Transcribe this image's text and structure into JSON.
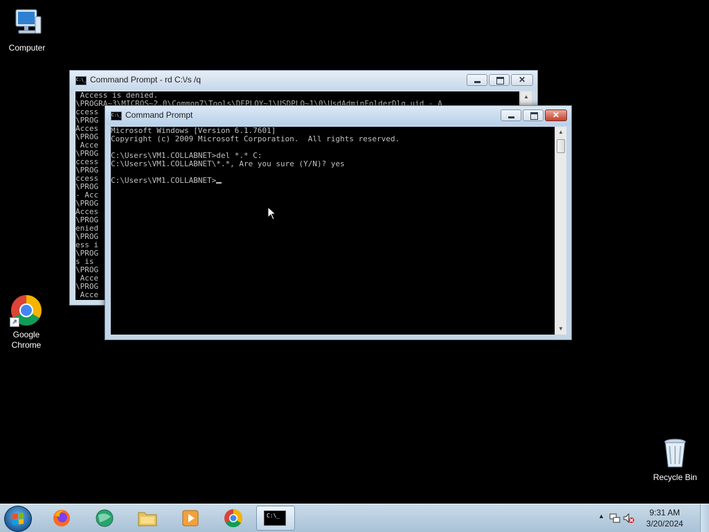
{
  "desktop": {
    "icons": [
      {
        "label": "Computer"
      },
      {
        "label": "Google Chrome"
      },
      {
        "label": "Recycle Bin"
      }
    ]
  },
  "back_window": {
    "title": "Command Prompt - rd  C:\\/s /q",
    "lines": [
      " Access is denied.",
      "\\PROGRA~3\\MICROS~2.0\\Common7\\Tools\\DEPLOY~1\\USDPLO~1\\0\\UsdAdminFolderDlg.uid - A",
      "ccess",
      "\\PROG",
      "Acces",
      "\\PROG",
      " Acce",
      "\\PROG",
      "ccess",
      "\\PROG",
      "ccess",
      "\\PROG",
      "- Acc",
      "\\PROG",
      "Acces",
      "\\PROG",
      "enied",
      "\\PROG",
      "ess i",
      "\\PROG",
      "s is",
      "\\PROG",
      " Acce",
      "\\PROG",
      " Acce"
    ]
  },
  "front_window": {
    "title": "Command Prompt",
    "lines": [
      "Microsoft Windows [Version 6.1.7601]",
      "Copyright (c) 2009 Microsoft Corporation.  All rights reserved.",
      "",
      "C:\\Users\\VM1.COLLABNET>del *.* C:",
      "C:\\Users\\VM1.COLLABNET\\*.*, Are you sure (Y/N)? yes",
      "",
      "C:\\Users\\VM1.COLLABNET>"
    ]
  },
  "window_buttons": {
    "minimize": "—",
    "maximize": "□",
    "close": "✕"
  },
  "taskbar": {
    "items": [
      {
        "name": "firefox",
        "icon": "firefox-icon"
      },
      {
        "name": "network-app",
        "icon": "globe-icon"
      },
      {
        "name": "file-explorer",
        "icon": "folder-icon"
      },
      {
        "name": "media-player",
        "icon": "play-icon"
      },
      {
        "name": "chrome",
        "icon": "chrome-icon"
      },
      {
        "name": "command-prompt",
        "icon": "cmd-icon",
        "active": true
      }
    ],
    "cmd_icon_text": "C:\\_"
  },
  "tray": {
    "show_hidden": "▲",
    "time": "9:31 AM",
    "date": "3/20/2024"
  },
  "colors": {
    "desktop": "#000000",
    "console_text": "#c0c0c0",
    "close_button": "#c8402d"
  }
}
